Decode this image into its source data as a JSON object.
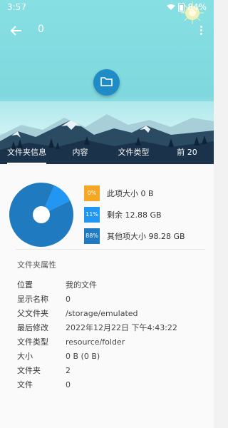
{
  "status": {
    "time": "3:57",
    "battery": "84%"
  },
  "toolbar": {
    "title": "0"
  },
  "tabs": [
    {
      "label": "文件夹信息"
    },
    {
      "label": "内容"
    },
    {
      "label": "文件类型"
    },
    {
      "label": "前 20"
    }
  ],
  "chart_data": {
    "type": "pie",
    "slices": [
      {
        "label": "此项大小 0 B",
        "percent": 0,
        "color": "#f5a623"
      },
      {
        "label": "剩余 12.88 GB",
        "percent": 11,
        "color": "#2196f3"
      },
      {
        "label": "其他项大小 98.28 GB",
        "percent": 88,
        "color": "#1f7ac0"
      }
    ]
  },
  "legend": [
    {
      "pct": "0%",
      "text": "此项大小 0 B"
    },
    {
      "pct": "11%",
      "text": "剩余 12.88 GB"
    },
    {
      "pct": "88%",
      "text": "其他项大小 98.28 GB"
    }
  ],
  "properties": {
    "section_title": "文件夹属性",
    "rows": [
      {
        "key": "位置",
        "value": "我的文件"
      },
      {
        "key": "显示名称",
        "value": "0"
      },
      {
        "key": "父文件夹",
        "value": "/storage/emulated"
      },
      {
        "key": "最后修改",
        "value": "2022年12月22日 下午4:43:22"
      },
      {
        "key": "文件类型",
        "value": "resource/folder"
      },
      {
        "key": "大小",
        "value": "0 B (0 B)"
      },
      {
        "key": "文件夹",
        "value": "2"
      },
      {
        "key": "文件",
        "value": "0"
      }
    ]
  },
  "icons": {
    "back": "arrow-left-icon",
    "more": "more-vert-icon",
    "folder": "folder-icon",
    "wifi": "wifi-icon",
    "battery": "battery-icon",
    "sun": "sun-icon"
  }
}
